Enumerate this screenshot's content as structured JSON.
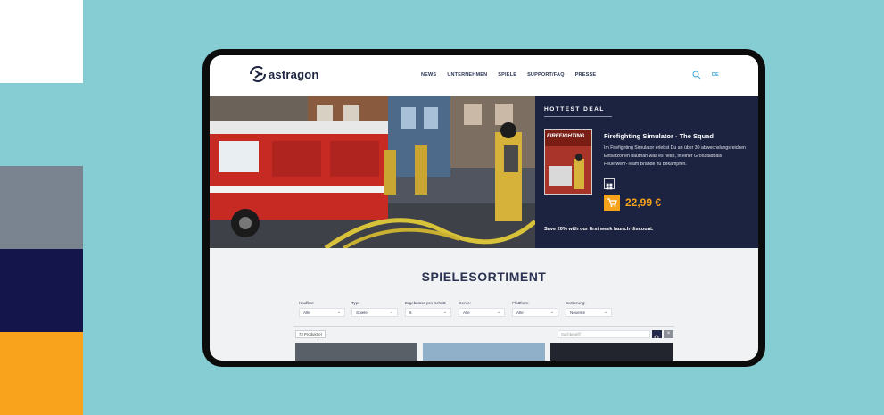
{
  "colors": {
    "background": "#86cdd3",
    "swatches": [
      "#ffffff",
      "#7a8490",
      "#14154a",
      "#f9a21b"
    ],
    "accent_orange": "#f7a21b",
    "navy": "#1c2341"
  },
  "header": {
    "logo_text": "astragon",
    "nav": [
      "NEWS",
      "UNTERNEHMEN",
      "SPIELE",
      "SUPPORT/FAQ",
      "PRESSE"
    ],
    "search_icon": "search-icon",
    "language": "DE"
  },
  "hero": {
    "deal_heading": "HOTTEST DEAL",
    "cover_title": "FIREFIGHTING",
    "game_title": "Firefighting Simulator - The Squad",
    "description": "Im Firefighting Simulator erlebst Du an über 30 abwechslungsreichen Einsatzorten hautnah was es heißt, in einer Großstadt als Feuerwehr-Team Brände zu bekämpfen.",
    "platform_icon": "windows-icon",
    "cart_icon": "cart-icon",
    "price": "22,99 €",
    "promo": "Save 20% with our first week launch discount."
  },
  "catalog": {
    "title": "SPIELESORTIMENT",
    "filters": [
      {
        "label": "Kaufbar:",
        "value": "Alle"
      },
      {
        "label": "Typ:",
        "value": "Spiele"
      },
      {
        "label": "Ergebnisse pro Schritt:",
        "value": "6"
      },
      {
        "label": "Genre:",
        "value": "Alle"
      },
      {
        "label": "Plattform:",
        "value": "Alle"
      },
      {
        "label": "Sortierung:",
        "value": "Neueste"
      }
    ],
    "count": "73 Produkt(e)",
    "search_placeholder": "Suchbegriff",
    "clear_label": "×"
  }
}
